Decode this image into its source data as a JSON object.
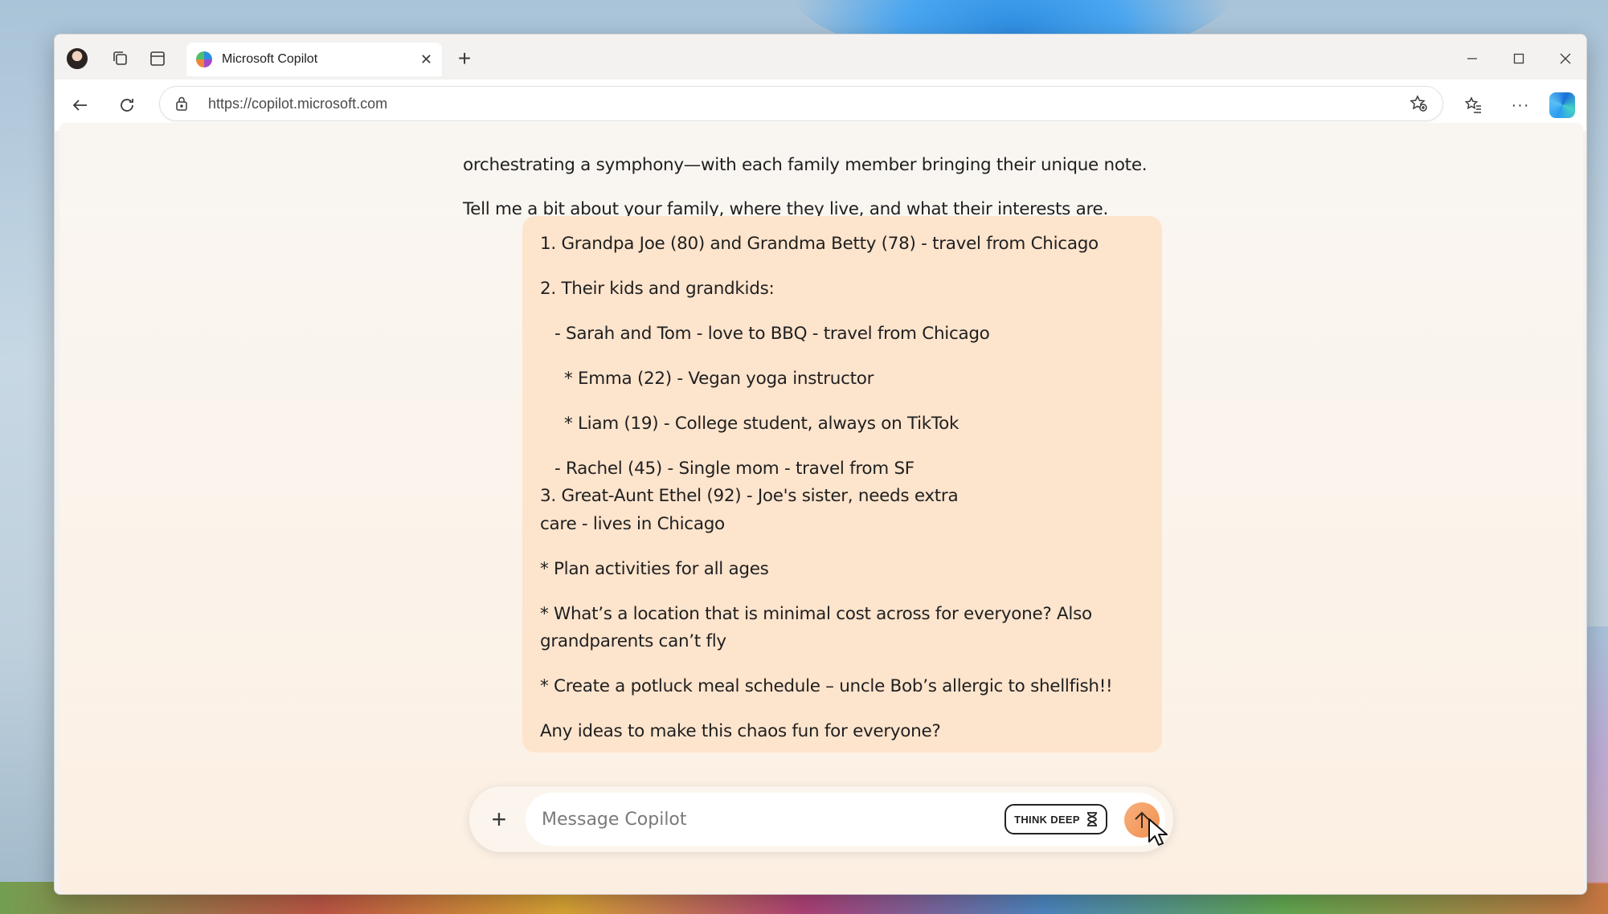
{
  "browser": {
    "tab_title": "Microsoft Copilot",
    "tab_close": "✕",
    "new_tab": "+",
    "url": "https://copilot.microsoft.com",
    "window_controls": {
      "minimize": "—",
      "maximize": "☐",
      "close": "✕"
    },
    "more_menu": "···"
  },
  "chat": {
    "assistant_lines": [
      "orchestrating a symphony—with each family member bringing their unique note.",
      "Tell me a bit about your family, where they live, and what their interests are."
    ],
    "user_message_lines": [
      "1. Grandpa Joe (80) and Grandma Betty (78) - travel from Chicago",
      "2. Their kids and grandkids:",
      "  - Sarah and Tom - love to BBQ - travel from Chicago",
      "    * Emma (22) - Vegan yoga instructor",
      "    * Liam (19) - College student, always on TikTok",
      "  - Rachel (45) - Single mom - travel from SF",
      "3. Great-Aunt Ethel (92) - Joe's sister, needs extra",
      "care - lives in Chicago",
      "* Plan activities for all ages",
      "* What’s a location that is minimal cost across for everyone? Also",
      "grandparents can’t fly",
      "* Create a potluck meal schedule – uncle Bob’s allergic to shellfish!!",
      "Any ideas to make this chaos fun for everyone?"
    ]
  },
  "composer": {
    "plus_label": "+",
    "placeholder": "Message Copilot",
    "think_deep_label": "THINK DEEP"
  },
  "icons": {
    "profile": "avatar",
    "workspaces": "workspaces-icon",
    "tab_actions": "tab-actions-icon",
    "back": "back-arrow-icon",
    "refresh": "refresh-icon",
    "lock": "lock-icon",
    "add_favorite": "star-add-icon",
    "favorites": "favorites-icon",
    "copilot": "copilot-icon",
    "send": "arrow-up-icon",
    "hourglass": "hourglass-icon"
  },
  "colors": {
    "user_bubble": "#fde4cd",
    "send_button": "#f0904f",
    "content_bg": "#fbf3ea"
  }
}
